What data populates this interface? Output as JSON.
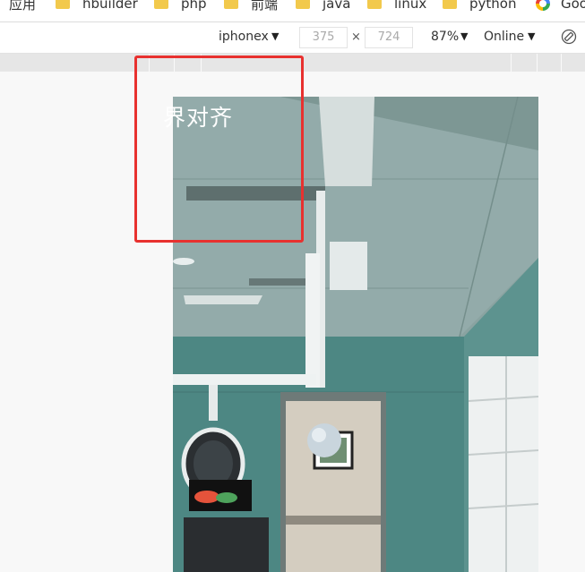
{
  "bookmarks": [
    {
      "label": "应用",
      "icon": "apps-icon"
    },
    {
      "label": "hbuilder",
      "icon": "folder-icon"
    },
    {
      "label": "php",
      "icon": "folder-icon"
    },
    {
      "label": "前端",
      "icon": "folder-icon"
    },
    {
      "label": "java",
      "icon": "folder-icon"
    },
    {
      "label": "linux",
      "icon": "folder-icon"
    },
    {
      "label": "python",
      "icon": "folder-icon"
    },
    {
      "label": "Goo",
      "icon": "google-icon"
    }
  ],
  "devtools": {
    "device": "iphonex",
    "width": "375",
    "times": "×",
    "height": "724",
    "zoom": "87%",
    "network": "Online",
    "arrow": "▼"
  },
  "preview": {
    "text": "界对齐",
    "image": "operating-room-panorama",
    "colors": {
      "wall": "#4f8a86",
      "ceiling": "#8fa7a5",
      "highlight": "#e8312f"
    }
  }
}
